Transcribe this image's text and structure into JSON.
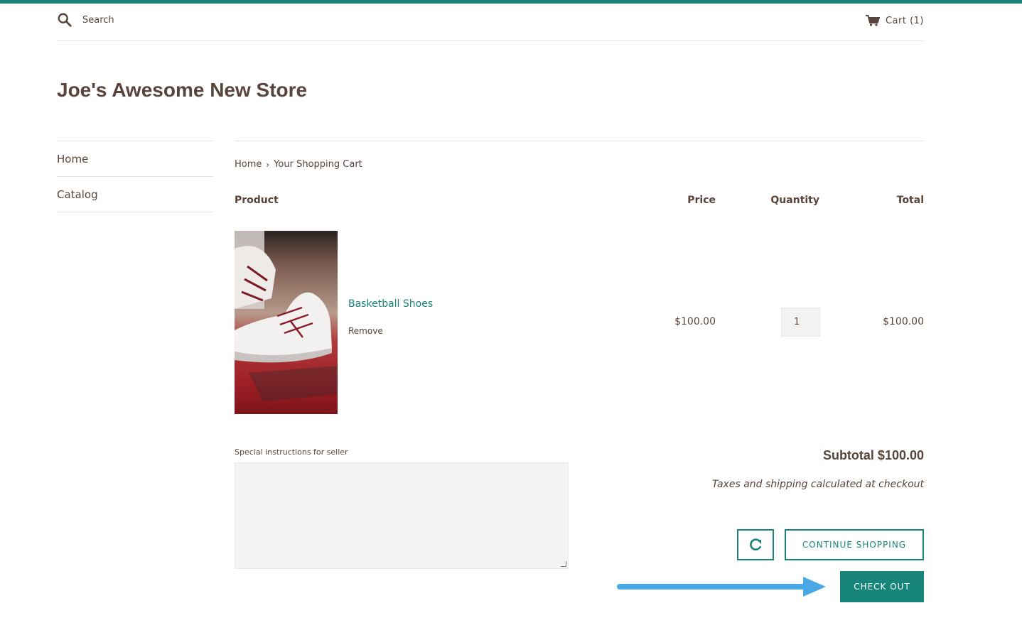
{
  "header": {
    "search_placeholder": "Search",
    "cart_label": "Cart (1)"
  },
  "store": {
    "title": "Joe's Awesome New Store"
  },
  "sidebar": {
    "items": [
      {
        "label": "Home"
      },
      {
        "label": "Catalog"
      }
    ]
  },
  "breadcrumb": {
    "home": "Home",
    "separator": "›",
    "current": "Your Shopping Cart"
  },
  "cart": {
    "columns": {
      "product": "Product",
      "price": "Price",
      "quantity": "Quantity",
      "total": "Total"
    },
    "items": [
      {
        "name": "Basketball Shoes",
        "remove_label": "Remove",
        "price": "$100.00",
        "quantity": "1",
        "total": "$100.00"
      }
    ],
    "instructions_label": "Special instructions for seller",
    "subtotal": "Subtotal $100.00",
    "taxes_note": "Taxes and shipping calculated at checkout",
    "continue_label": "CONTINUE SHOPPING",
    "checkout_label": "CHECK OUT"
  },
  "colors": {
    "accent": "#17857a",
    "text": "#58443a",
    "annotation_arrow": "#4aa9e4"
  },
  "icons": {
    "search": "search-icon",
    "cart": "cart-icon",
    "update": "refresh-icon"
  }
}
